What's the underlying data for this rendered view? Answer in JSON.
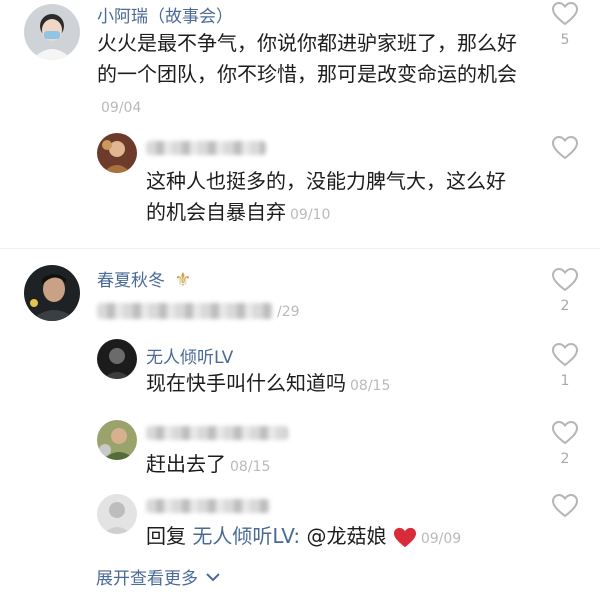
{
  "comments": [
    {
      "name": "小阿瑞（故事会）",
      "text": "火火是最不争气，你说你都进驴家班了，那么好的一个团队，你不珍惜，那可是改变命运的机会",
      "date": "09/04",
      "likes": "5"
    },
    {
      "name": "",
      "text": "这种人也挺多的，没能力脾气大，这么好的机会自暴自弃",
      "date": "09/10",
      "likes": ""
    },
    {
      "name": "春夏秋冬",
      "text": "",
      "date": "/29",
      "likes": "2"
    },
    {
      "name": "无人倾听LV",
      "text": "现在快手叫什么知道吗",
      "date": "08/15",
      "likes": "1"
    },
    {
      "name": "",
      "text": "赶出去了",
      "date": "08/15",
      "likes": "2"
    },
    {
      "name": "",
      "reply_prefix": "回复",
      "mention": "无人倾听LV:",
      "text_mention": "@龙菇娘",
      "date": "09/09",
      "likes": ""
    }
  ],
  "expand_label": "展开查看更多",
  "icons": {
    "like": "heart-outline-icon",
    "expand": "chevron-down-icon",
    "emoji": "red-heart-emoji-icon",
    "badge": "fleur-de-lis-icon"
  },
  "colors": {
    "name": "#4a6a98",
    "date": "#b9b9b9",
    "heart": "#d92b3a"
  }
}
